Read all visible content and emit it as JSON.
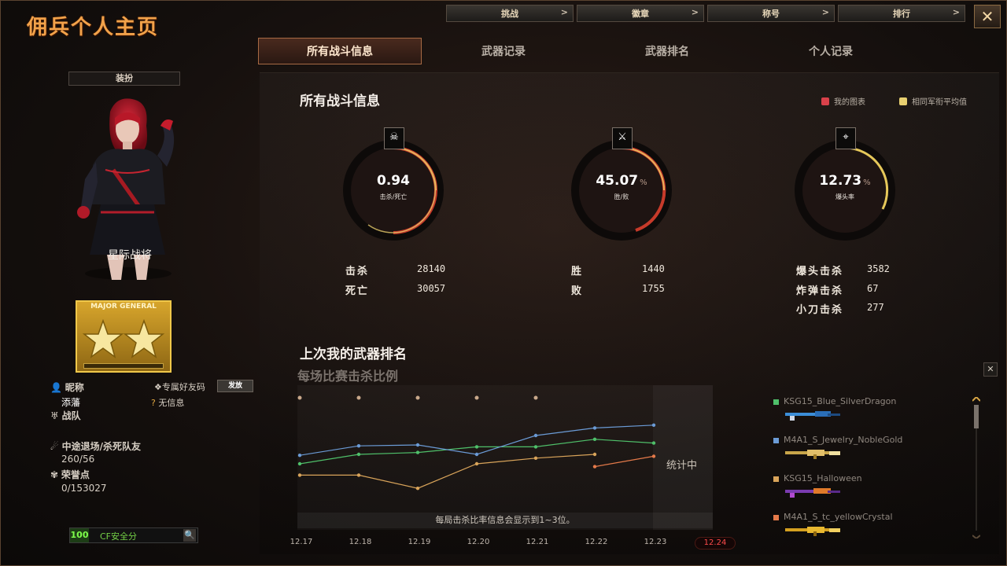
{
  "window": {
    "title": "佣兵个人主页",
    "close_icon": "close-icon"
  },
  "top_nav": [
    {
      "label": "挑战",
      "icon": "chevron-right-icon"
    },
    {
      "label": "徽章",
      "icon": "chevron-right-icon"
    },
    {
      "label": "称号",
      "icon": "chevron-right-icon"
    },
    {
      "label": "排行",
      "icon": "chevron-right-icon"
    }
  ],
  "tabs": [
    {
      "label": "所有战斗信息",
      "active": true
    },
    {
      "label": "武器记录",
      "active": false
    },
    {
      "label": "武器排名",
      "active": false
    },
    {
      "label": "个人记录",
      "active": false
    }
  ],
  "profile": {
    "dress_button": "装扮",
    "character_name": "星际战将",
    "rank_badge": "MAJOR GENERAL",
    "nickname_label": "昵称",
    "nickname_value": "添藩",
    "friend_code_label": "专属好友码",
    "friend_code_button": "发放",
    "friend_code_value": "无信息",
    "team_label": "战队",
    "quit_label": "中途退场/杀死队友",
    "quit_value": "260/56",
    "honor_label": "荣誉点",
    "honor_value": "0/153027",
    "safety_score": "100",
    "safety_label": "CF安全分"
  },
  "battle": {
    "heading": "所有战斗信息",
    "legend_mine": "我的图表",
    "legend_avg": "相同军衔平均值",
    "legend_colors": {
      "mine": "#d9414a",
      "avg": "#e8d070"
    },
    "gauges": [
      {
        "value": "0.94",
        "caption": "击杀/死亡",
        "icon": "skull-icon",
        "pct": ""
      },
      {
        "value": "45.07",
        "caption": "胜/败",
        "icon": "crossed-swords-icon",
        "pct": "%"
      },
      {
        "value": "12.73",
        "caption": "爆头率",
        "icon": "rifle-icon",
        "pct": "%"
      }
    ],
    "kills_label": "击杀",
    "kills_value": "28140",
    "deaths_label": "死亡",
    "deaths_value": "30057",
    "wins_label": "胜",
    "wins_value": "1440",
    "losses_label": "败",
    "losses_value": "1755",
    "headshot_label": "爆头击杀",
    "headshot_value": "3582",
    "bomb_label": "炸弹击杀",
    "bomb_value": "67",
    "knife_label": "小刀击杀",
    "knife_value": "277"
  },
  "weapon_rank": {
    "heading": "上次我的武器排名",
    "subheading": "每场比赛击杀比例",
    "note": "每局击杀比率信息会显示到1~3位。",
    "counting": "统计中",
    "close_icon": "close-icon",
    "dates": [
      "12.17",
      "12.18",
      "12.19",
      "12.20",
      "12.21",
      "12.22",
      "12.23",
      "12.24"
    ],
    "active_date": "12.24",
    "weapons": [
      {
        "name": "KSG15_Blue_SilverDragon",
        "color": "#4fc06a",
        "icon": "shotgun-icon"
      },
      {
        "name": "M4A1_S_Jewelry_NobleGold",
        "color": "#6b9bd6",
        "icon": "rifle-icon"
      },
      {
        "name": "KSG15_Halloween",
        "color": "#d9a45a",
        "icon": "shotgun-icon"
      },
      {
        "name": "M4A1_S_tc_yellowCrystal",
        "color": "#e57a4a",
        "icon": "rifle-icon"
      }
    ]
  },
  "chart_data": {
    "type": "line",
    "title": "每场比赛击杀比例",
    "x": [
      "12.17",
      "12.18",
      "12.19",
      "12.20",
      "12.21",
      "12.22",
      "12.23"
    ],
    "series": [
      {
        "name": "KSG15_Blue_SilverDragon",
        "color": "#4fc06a",
        "values": [
          0.5,
          0.6,
          0.62,
          0.68,
          0.68,
          0.76,
          0.72
        ]
      },
      {
        "name": "M4A1_S_Jewelry_NobleGold",
        "color": "#6b9bd6",
        "values": [
          0.59,
          0.69,
          0.7,
          0.6,
          0.8,
          0.88,
          0.91
        ]
      },
      {
        "name": "KSG15_Halloween",
        "color": "#d9a45a",
        "values": [
          0.38,
          0.38,
          0.24,
          0.5,
          0.56,
          0.6,
          null
        ]
      },
      {
        "name": "M4A1_S_tc_yellowCrystal",
        "color": "#e57a4a",
        "values": [
          null,
          null,
          null,
          null,
          null,
          0.47,
          0.58
        ]
      }
    ],
    "markers": [
      "12.17",
      "12.18",
      "12.19",
      "12.20",
      "12.21"
    ],
    "ylim": [
      0,
      1.2
    ],
    "grid": false
  }
}
